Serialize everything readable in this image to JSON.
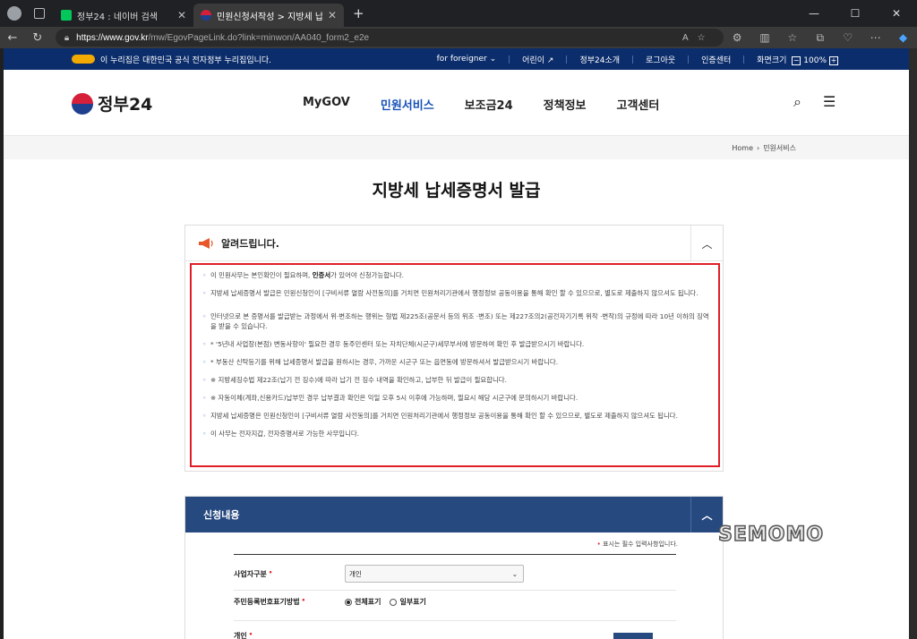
{
  "browser": {
    "tabs": [
      {
        "label": "정부24 : 네이버 검색",
        "active": false
      },
      {
        "label": "민원신청서작성 > 지방세 납세증",
        "active": true
      }
    ],
    "url_host": "https://www.gov.kr",
    "url_path": "/mw/EgovPageLink.do?link=minwon/AA040_form2_e2e"
  },
  "gov_bar": {
    "notice": "이 누리집은 대한민국 공식 전자정부 누리집입니다.",
    "links": [
      "for foreigner",
      "어린이",
      "정부24소개",
      "로그아웃",
      "인증센터"
    ],
    "zoom_label": "화면크기",
    "zoom_value": "100%"
  },
  "header": {
    "logo": "정부24",
    "nav": [
      {
        "label": "MyGOV",
        "active": false
      },
      {
        "label": "민원서비스",
        "active": true
      },
      {
        "label": "보조금24",
        "active": false
      },
      {
        "label": "정책정보",
        "active": false
      },
      {
        "label": "고객센터",
        "active": false
      }
    ]
  },
  "breadcrumb": {
    "home": "Home",
    "current": "민원서비스"
  },
  "page_title": "지방세 납세증명서 발급",
  "notice": {
    "title": "알려드립니다.",
    "items": [
      {
        "pre": "이 민원사무는 본인확인이 필요하며, ",
        "bold": "인증서",
        "post": "가 있어야 신청가능합니다."
      },
      {
        "text": "지방세 납세증명서 발급은 민원신청인이 [구비서류 열람 사전동의]를 거치면 민원처리기관에서 행정정보 공동이용을 통해 확인 할 수 있으므로, 별도로 제출하지 않으셔도 됩니다."
      },
      {
        "text": "인터넷으로 본 증명서를 발급받는 과정에서 위·변조하는 행위는 형법 제225조(공문서 등의 위조 ·변조) 또는 제227조의2(공전자기기록 위작 ·변작)의 규정에 따라 10년 이하의 징역을 받을 수 있습니다."
      },
      {
        "text": " * '5년내 사업장(본점) 변동사항이' 필요한 경우 동주민센터 또는 자치단체(시군구)세무부서에 방문하여 확인 후 발급받으시기 바랍니다."
      },
      {
        "text": " * 부동산 신탁등기를 위해 납세증명서 발급을 원하시는 경우, 가까운 시군구 또는 읍면동에 방문하셔서 발급받으시기 바랍니다."
      },
      {
        "text": "※ 지방세징수법 제22조(납기 전 징수)에 따라 납기 전 징수 내역을 확인하고, 납부한 뒤 발급이 필요합니다."
      },
      {
        "text": "※ 자동이체(계좌,신용카드)납부인 경우 납부결과 확인은 익일 오후 5시 이후에 가능하며, 필요시 해당 시군구에 문의하시기 바랍니다."
      },
      {
        "text": "지방세 납세증명은 민원신청인이 [구비서류 열람 사전동의]를 거치면 민원처리기관에서 행정정보 공동이용을 통해 확인 할 수 있으므로, 별도로 제출하지 않으셔도 됩니다."
      },
      {
        "text": "이 사무는 전자지갑, 전자증명서로 가능한 사무입니다."
      }
    ]
  },
  "apply": {
    "title": "신청내용",
    "required_note": "표시는 필수 입력사항입니다.",
    "fields": {
      "biz_type_label": "사업자구분",
      "biz_type_value": "개인",
      "rrn_label": "주민등록번호표기방법",
      "rrn_options": [
        "전체표기",
        "일부표기"
      ],
      "personal_label": "개인"
    }
  },
  "watermark": "SEMOMO",
  "colors": {
    "gov_blue": "#0c2d6b",
    "active_nav": "#1751b8",
    "panel_header": "#264a80",
    "highlight_red": "#e01e27"
  }
}
